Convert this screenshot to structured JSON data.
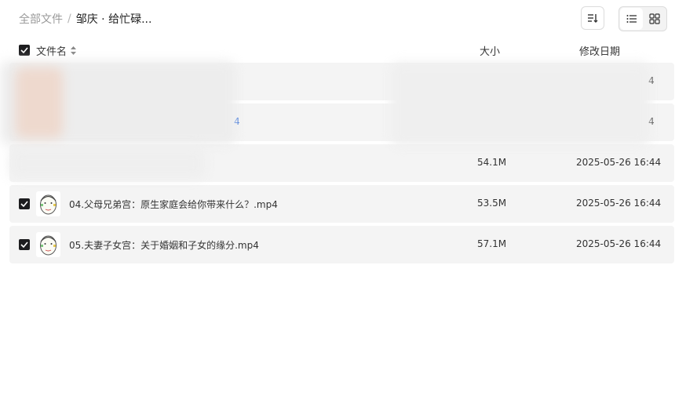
{
  "breadcrumb": {
    "root": "全部文件",
    "separator": "/",
    "current": "邹庆 · 给忙碌..."
  },
  "toolbar": {
    "sort_icon": "sort-lines-icon",
    "view_list_icon": "list-view-icon",
    "view_grid_icon": "grid-view-icon",
    "active_view": "grid"
  },
  "table": {
    "columns": {
      "name": "文件名",
      "size": "大小",
      "date": "修改日期"
    },
    "rows": [
      {
        "name": "",
        "size": "",
        "date": "4",
        "checked": false
      },
      {
        "name": "4",
        "size": "",
        "date": "4",
        "checked": false
      },
      {
        "name": "",
        "size": "54.1M",
        "date": "2025-05-26 16:44",
        "checked": false
      },
      {
        "name": "04.父母兄弟宫：原生家庭会给你带来什么？.mp4",
        "size": "53.5M",
        "date": "2025-05-26 16:44",
        "checked": true
      },
      {
        "name": "05.夫妻子女宫：关于婚姻和子女的缘分.mp4",
        "size": "57.1M",
        "date": "2025-05-26 16:44",
        "checked": true
      }
    ]
  },
  "colors": {
    "row_bg": "#f4f4f4",
    "checkbox": "#1d1d1f",
    "muted_text": "#9a9a9a"
  }
}
